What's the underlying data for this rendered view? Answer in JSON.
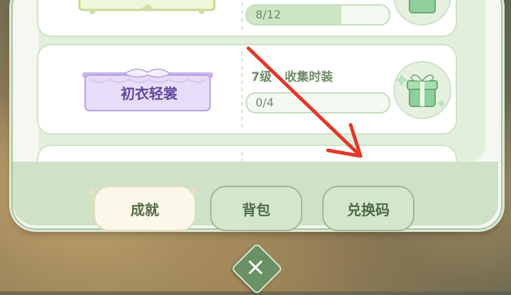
{
  "rewards": [
    {
      "task_label": "",
      "progress_text": "8/12",
      "progress_fraction": 0.667
    },
    {
      "banner_text": "初衣轻裳",
      "task_label": "7级 · 收集时装",
      "progress_text": "0/4",
      "progress_fraction": 0
    }
  ],
  "tabs": [
    {
      "label": "成就",
      "active": true
    },
    {
      "label": "背包",
      "active": false
    },
    {
      "label": "兑换码",
      "active": false
    }
  ],
  "close_button": {
    "icon": "close-icon"
  },
  "annotation": {
    "color": "#e2382a"
  }
}
